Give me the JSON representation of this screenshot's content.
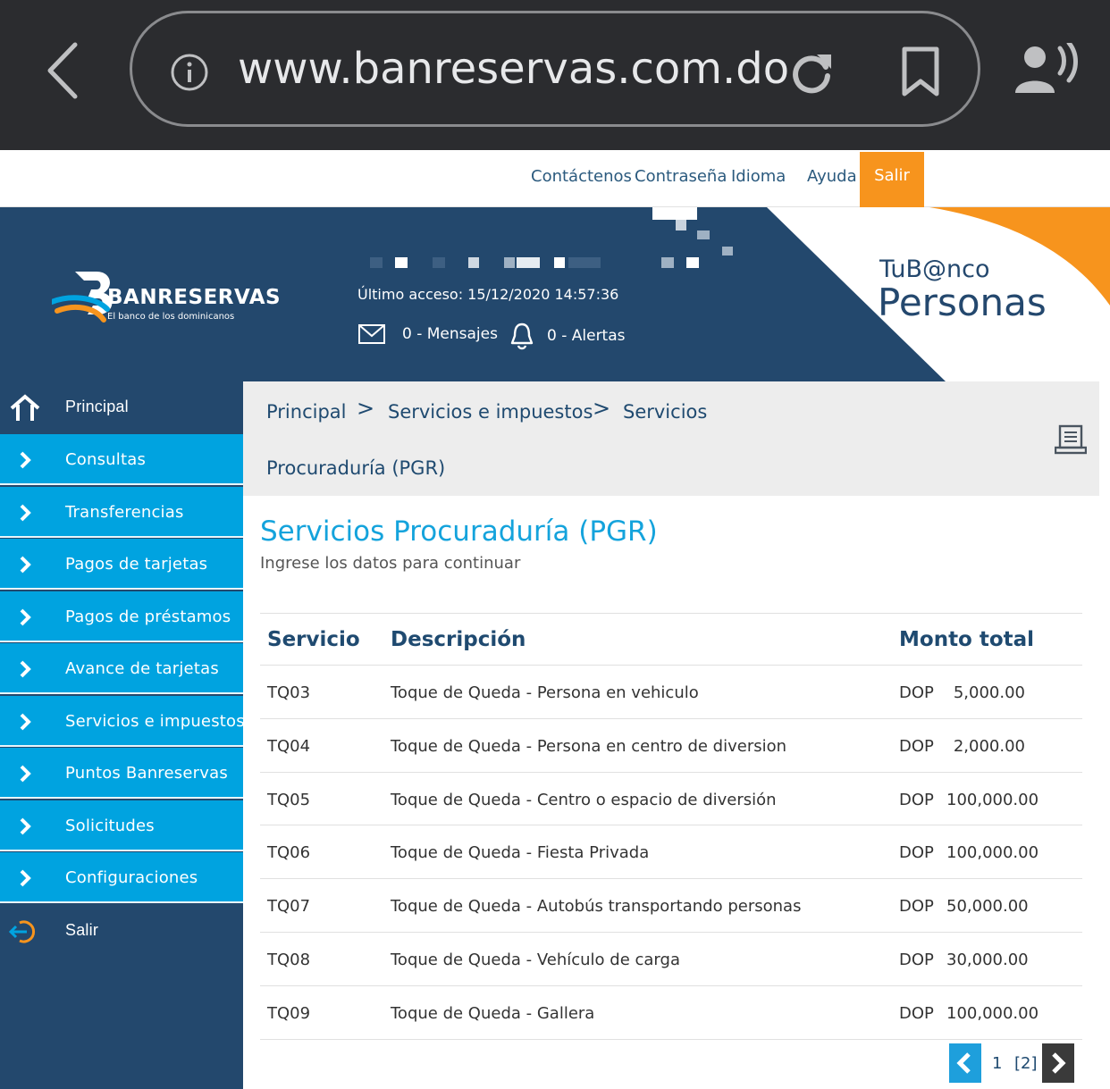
{
  "browser": {
    "url": "www.banreservas.com.do"
  },
  "top_links": {
    "contact": "Contáctenos",
    "password": "Contraseña",
    "language": "Idioma",
    "help": "Ayuda",
    "logout": "Salir"
  },
  "header": {
    "brand": "BANRESERVAS",
    "tagline": "El banco de los dominicanos",
    "last_access": "Último acceso: 15/12/2020 14:57:36",
    "messages": "0 - Mensajes",
    "alerts": "0 - Alertas",
    "product_line1": "TuB@nco",
    "product_line2": "Personas"
  },
  "sidebar": {
    "home": "Principal",
    "items": [
      "Consultas",
      "Transferencias",
      "Pagos de tarjetas",
      "Pagos de préstamos",
      "Avance de tarjetas",
      "Servicios e impuestos",
      "Puntos Banreservas",
      "Solicitudes",
      "Configuraciones"
    ],
    "logout": "Salir"
  },
  "breadcrumb": {
    "level1": "Principal",
    "sep": ">",
    "level2": "Servicios e impuestos",
    "level3_part1": "Servicios",
    "level3_part2": "Procuraduría (PGR)"
  },
  "main": {
    "title": "Servicios Procuraduría (PGR)",
    "subtitle": "Ingrese los datos para continuar",
    "columns": [
      "Servicio",
      "Descripción",
      "Monto total"
    ],
    "rows": [
      {
        "code": "TQ03",
        "desc": "Toque de Queda - Persona en vehiculo",
        "currency": "DOP",
        "amount": "5,000.00"
      },
      {
        "code": "TQ04",
        "desc": "Toque de Queda - Persona en centro de diversion",
        "currency": "DOP",
        "amount": "2,000.00"
      },
      {
        "code": "TQ05",
        "desc": "Toque de Queda - Centro o espacio de diversión",
        "currency": "DOP",
        "amount": "100,000.00"
      },
      {
        "code": "TQ06",
        "desc": "Toque de Queda - Fiesta Privada",
        "currency": "DOP",
        "amount": "100,000.00"
      },
      {
        "code": "TQ07",
        "desc": "Toque de Queda - Autobús transportando personas",
        "currency": "DOP",
        "amount": "50,000.00"
      },
      {
        "code": "TQ08",
        "desc": "Toque de Queda - Vehículo de carga",
        "currency": "DOP",
        "amount": "30,000.00"
      },
      {
        "code": "TQ09",
        "desc": "Toque de Queda - Gallera",
        "currency": "DOP",
        "amount": "100,000.00"
      }
    ],
    "pager": {
      "page1": "1",
      "page2": "[2]"
    }
  },
  "colors": {
    "navy": "#23486d",
    "cyan": "#00a3e0",
    "orange": "#f7941d",
    "title_blue": "#14a3dc"
  }
}
